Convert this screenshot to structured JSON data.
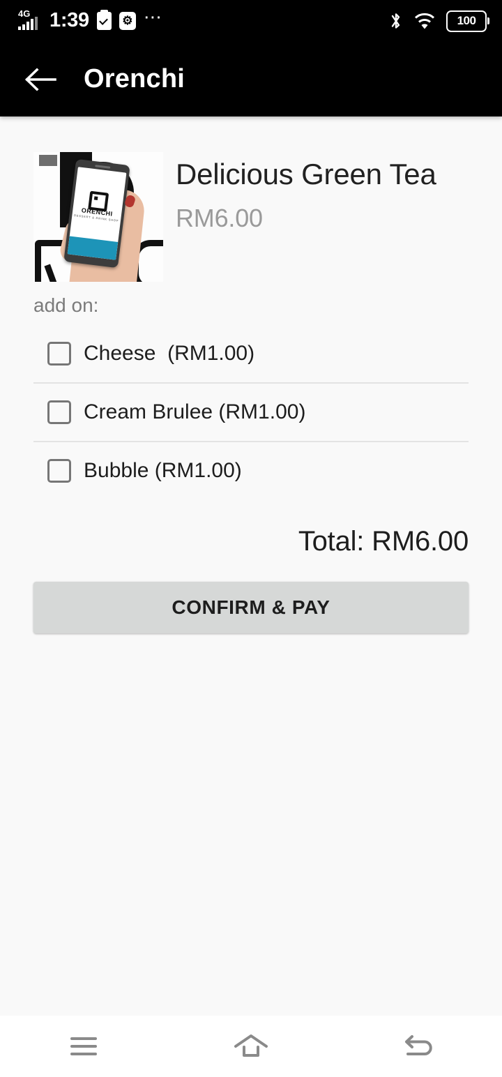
{
  "status_bar": {
    "network": "4G",
    "time": "1:39",
    "icons": [
      "signal-bars-icon",
      "clipboard-check-icon",
      "usb-settings-icon",
      "more-dots-icon",
      "bluetooth-icon",
      "wifi-icon"
    ],
    "battery_level": "100"
  },
  "app_bar": {
    "back_icon": "arrow-left-icon",
    "title": "Orenchi"
  },
  "product": {
    "image_alt": "orenchi-promo-photo",
    "title": "Delicious Green Tea",
    "price": "RM6.00",
    "image_logo_text": "ORENCHI",
    "image_logo_sub": "DESSERT & DRINK SHOP"
  },
  "addons": {
    "label": "add on:",
    "items": [
      {
        "name": "Cheese  (RM1.00)",
        "checked": false
      },
      {
        "name": "Cream Brulee (RM1.00)",
        "checked": false
      },
      {
        "name": "Bubble (RM1.00)",
        "checked": false
      }
    ]
  },
  "total": {
    "text": "Total: RM6.00"
  },
  "actions": {
    "confirm_label": "CONFIRM & PAY"
  },
  "nav_bar": {
    "recents": "menu-icon",
    "home": "home-icon",
    "back": "back-arrow-icon"
  },
  "colors": {
    "app_bar_bg": "#000000",
    "content_bg": "#f9f9f9",
    "button_bg": "#d6d8d7",
    "muted_text": "#9a9a9a",
    "accent_teal": "#1d94b8"
  }
}
